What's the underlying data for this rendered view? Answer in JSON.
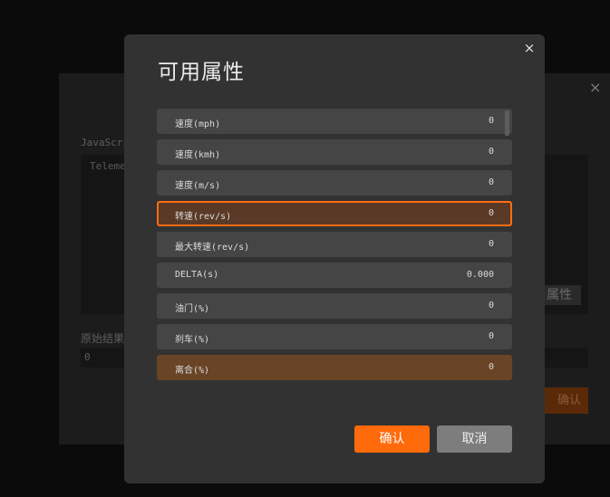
{
  "background": {
    "js_label": "JavaScri",
    "editor_text": "Teleme",
    "attr_button": "属性",
    "result_label": "原始结果",
    "result_value": "0",
    "confirm_label": "确认",
    "close": "×"
  },
  "modal": {
    "title": "可用属性",
    "close": "×",
    "items": [
      {
        "name": "速度(mph)",
        "value": "0"
      },
      {
        "name": "速度(kmh)",
        "value": "0"
      },
      {
        "name": "速度(m/s)",
        "value": "0"
      },
      {
        "name": "转速(rev/s)",
        "value": "0"
      },
      {
        "name": "最大转速(rev/s)",
        "value": "0"
      },
      {
        "name": "DELTA(s)",
        "value": "0.000"
      },
      {
        "name": "油门(%)",
        "value": "0"
      },
      {
        "name": "刹车(%)",
        "value": "0"
      },
      {
        "name": "离合(%)",
        "value": "0"
      }
    ],
    "ok_label": "确认",
    "cancel_label": "取消"
  },
  "colors": {
    "accent": "#ff6a0a",
    "selected_border": "#ff6d12",
    "modal_bg": "#323232",
    "row_bg": "#454545"
  }
}
